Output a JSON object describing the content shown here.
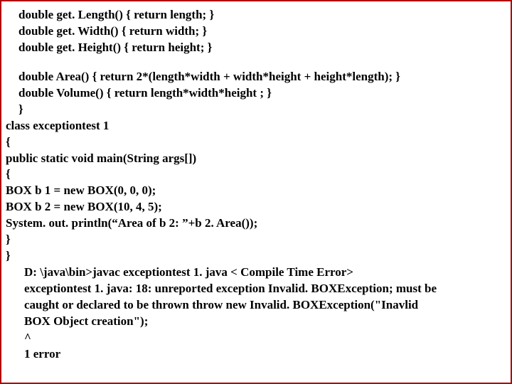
{
  "code": {
    "l1": "double get. Length() { return length; }",
    "l2": "double get. Width()  { return width;  }",
    "l3": "double get. Height() { return height; }",
    "l4": "double Area()   { return 2*(length*width + width*height + height*length); }",
    "l5": "double Volume() { return length*width*height ; }",
    "l6": "}",
    "l7": "class exceptiontest 1",
    "l8": "{",
    "l9": "public static void  main(String args[])",
    "l10": "{",
    "l11": "BOX b 1 = new BOX(0, 0, 0);",
    "l12": "BOX b 2 = new BOX(10, 4, 5);",
    "l13": "System. out. println(“Area of b 2: ”+b 2. Area());",
    "l14": "}",
    "l15": "}"
  },
  "output": {
    "o1": "D: \\java\\bin>javac exceptiontest 1. java  < Compile Time Error>",
    "o2": "exceptiontest 1. java: 18: unreported exception Invalid. BOXException; must be",
    "o3": "caught  or declared to be thrown throw new Invalid. BOXException(\"Inavlid",
    "o4": "BOX Object creation\");",
    "o5": "^",
    "o6": "1 error"
  }
}
